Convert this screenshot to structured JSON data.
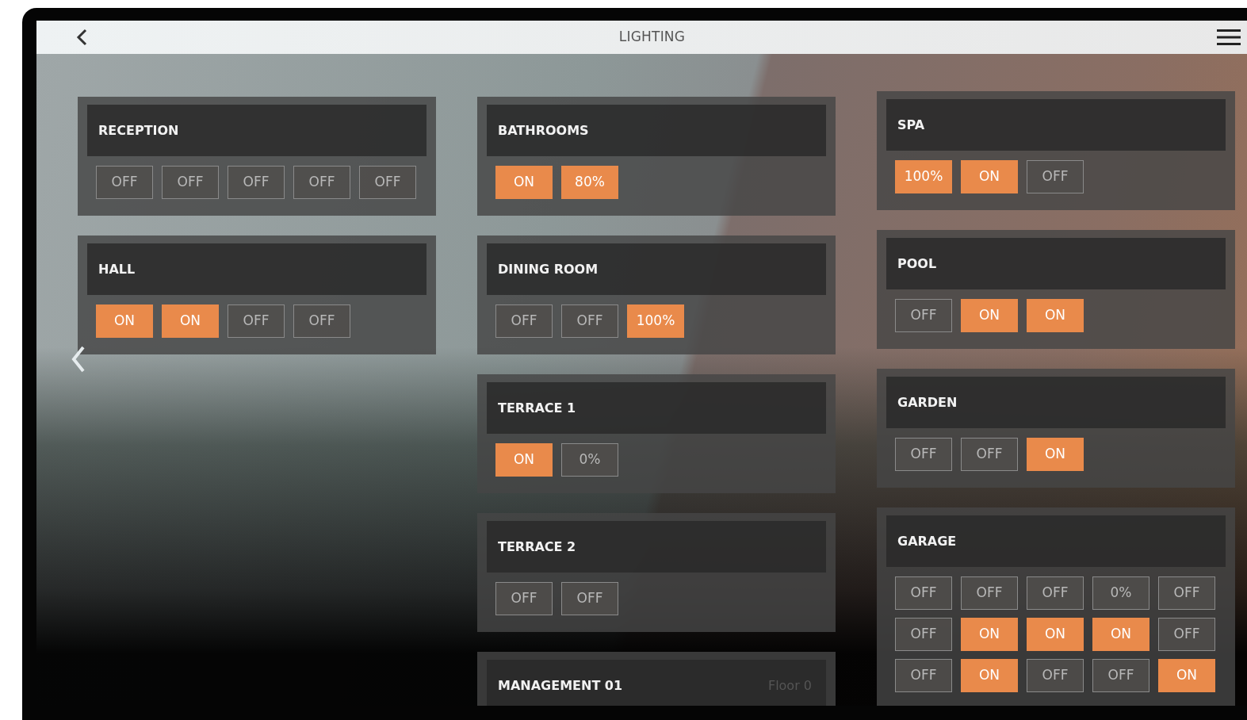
{
  "window": {
    "title": "LIGHTING"
  },
  "columns": [
    {
      "rooms": [
        {
          "name": "RECEPTION",
          "rows": [
            {
              "buttons": [
                {
                  "label": "OFF",
                  "on": false
                },
                {
                  "label": "OFF",
                  "on": false
                },
                {
                  "label": "OFF",
                  "on": false
                },
                {
                  "label": "OFF",
                  "on": false
                },
                {
                  "label": "OFF",
                  "on": false
                }
              ]
            }
          ]
        },
        {
          "name": "HALL",
          "rows": [
            {
              "buttons": [
                {
                  "label": "ON",
                  "on": true
                },
                {
                  "label": "ON",
                  "on": true
                },
                {
                  "label": "OFF",
                  "on": false
                },
                {
                  "label": "OFF",
                  "on": false
                }
              ]
            }
          ]
        }
      ]
    },
    {
      "rooms": [
        {
          "name": "BATHROOMS",
          "rows": [
            {
              "buttons": [
                {
                  "label": "ON",
                  "on": true
                },
                {
                  "label": "80%",
                  "on": true
                }
              ]
            }
          ]
        },
        {
          "name": "DINING ROOM",
          "rows": [
            {
              "buttons": [
                {
                  "label": "OFF",
                  "on": false
                },
                {
                  "label": "OFF",
                  "on": false
                },
                {
                  "label": "100%",
                  "on": true
                }
              ]
            }
          ]
        },
        {
          "name": "TERRACE 1",
          "rows": [
            {
              "buttons": [
                {
                  "label": "ON",
                  "on": true
                },
                {
                  "label": "0%",
                  "on": false
                }
              ]
            }
          ]
        },
        {
          "name": "TERRACE 2",
          "rows": [
            {
              "buttons": [
                {
                  "label": "OFF",
                  "on": false
                },
                {
                  "label": "OFF",
                  "on": false
                }
              ]
            }
          ]
        },
        {
          "name": "MANAGEMENT 01",
          "floor": "Floor 0"
        }
      ]
    },
    {
      "rooms": [
        {
          "name": "SPA",
          "rows": [
            {
              "buttons": [
                {
                  "label": "100%",
                  "on": true
                },
                {
                  "label": "ON",
                  "on": true
                },
                {
                  "label": "OFF",
                  "on": false
                }
              ]
            }
          ]
        },
        {
          "name": "POOL",
          "rows": [
            {
              "buttons": [
                {
                  "label": "OFF",
                  "on": false
                },
                {
                  "label": "ON",
                  "on": true
                },
                {
                  "label": "ON",
                  "on": true
                }
              ]
            }
          ]
        },
        {
          "name": "GARDEN",
          "rows": [
            {
              "buttons": [
                {
                  "label": "OFF",
                  "on": false
                },
                {
                  "label": "OFF",
                  "on": false
                },
                {
                  "label": "ON",
                  "on": true
                }
              ]
            }
          ]
        },
        {
          "name": "GARAGE",
          "rows": [
            {
              "buttons": [
                {
                  "label": "OFF",
                  "on": false
                },
                {
                  "label": "OFF",
                  "on": false
                },
                {
                  "label": "OFF",
                  "on": false
                },
                {
                  "label": "0%",
                  "on": false
                },
                {
                  "label": "OFF",
                  "on": false
                }
              ]
            },
            {
              "buttons": [
                {
                  "label": "OFF",
                  "on": false
                },
                {
                  "label": "ON",
                  "on": true
                },
                {
                  "label": "ON",
                  "on": true
                },
                {
                  "label": "ON",
                  "on": true
                },
                {
                  "label": "OFF",
                  "on": false
                }
              ]
            },
            {
              "buttons": [
                {
                  "label": "OFF",
                  "on": false
                },
                {
                  "label": "ON",
                  "on": true
                },
                {
                  "label": "OFF",
                  "on": false
                },
                {
                  "label": "OFF",
                  "on": false
                },
                {
                  "label": "ON",
                  "on": true
                }
              ]
            }
          ]
        }
      ]
    }
  ]
}
